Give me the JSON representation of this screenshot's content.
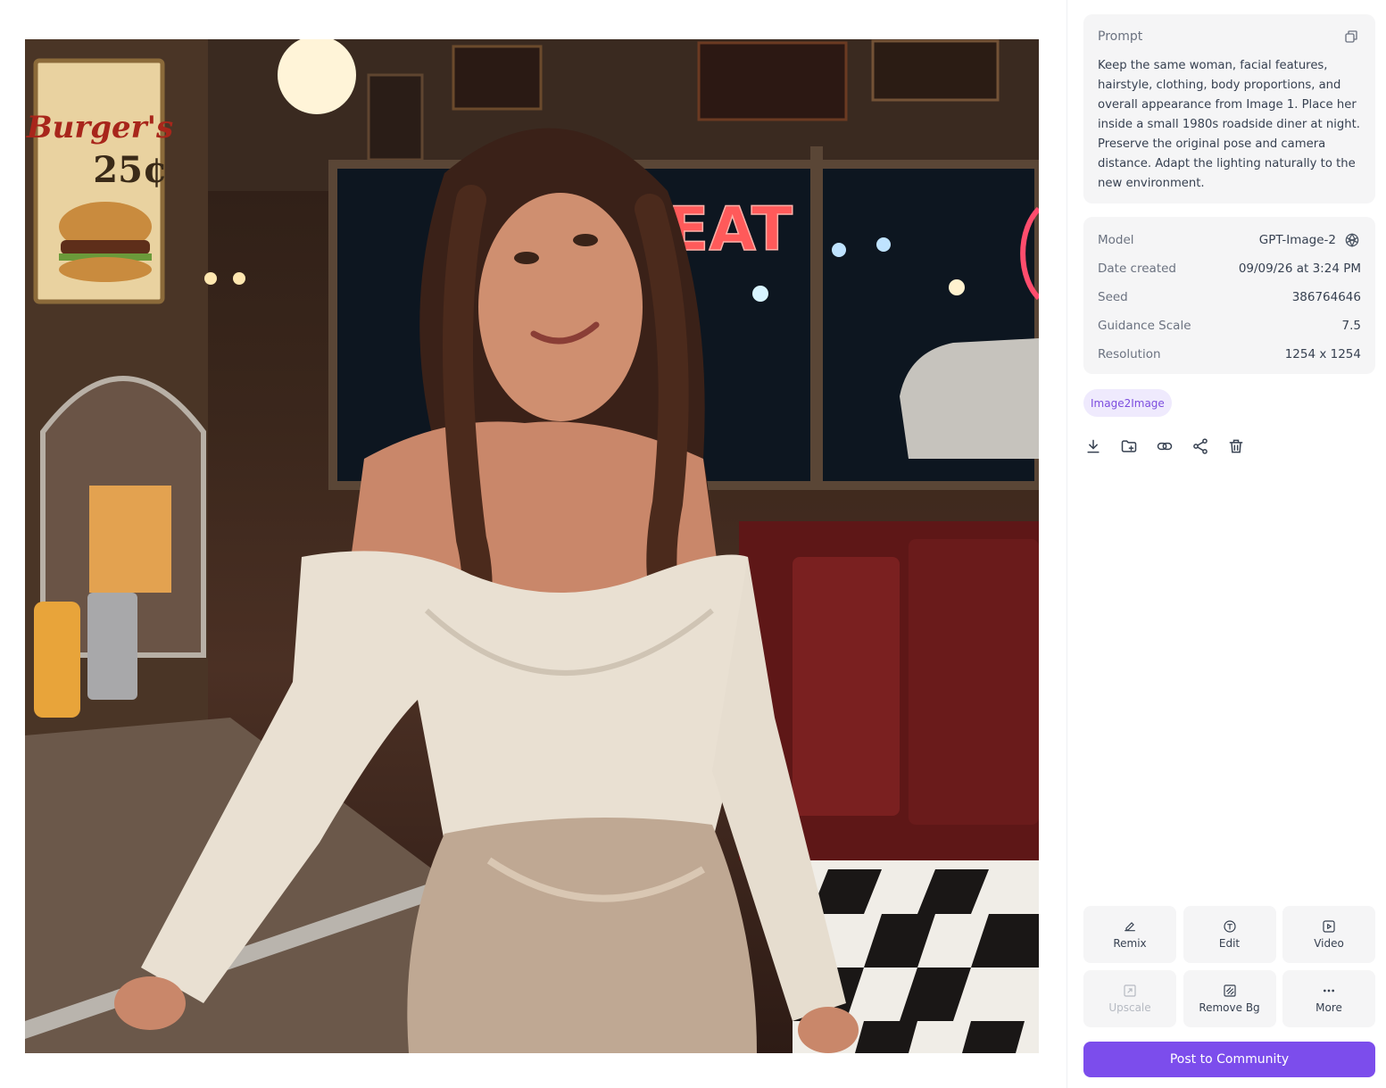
{
  "image": {
    "description_icon": "generated-photo",
    "sign_text": "Burger's",
    "sign_price": "25¢",
    "neon_text": "EAT"
  },
  "prompt": {
    "label": "Prompt",
    "text": "Keep the same woman, facial features, hairstyle, clothing, body proportions, and overall appearance from Image 1. Place her inside a small 1980s roadside diner at night. Preserve the original pose and camera distance. Adapt the lighting naturally to the new environment.",
    "copy_icon": "copy-icon"
  },
  "meta": {
    "model_label": "Model",
    "model_value": "GPT-Image-2",
    "model_icon": "openai-logo-icon",
    "date_label": "Date created",
    "date_value": "09/09/26 at 3:24 PM",
    "seed_label": "Seed",
    "seed_value": "386764646",
    "guidance_label": "Guidance Scale",
    "guidance_value": "7.5",
    "resolution_label": "Resolution",
    "resolution_value": "1254 x 1254"
  },
  "tag": "Image2Image",
  "actions": [
    "download-icon",
    "add-to-folder-icon",
    "link-icon",
    "share-icon",
    "trash-icon"
  ],
  "tools": {
    "remix": "Remix",
    "edit": "Edit",
    "video": "Video",
    "upscale": "Upscale",
    "remove_bg": "Remove Bg",
    "more": "More"
  },
  "post_button": "Post to Community",
  "colors": {
    "accent": "#7c4dec",
    "tag_bg": "#efeafd",
    "tag_text": "#7c4dde",
    "card_bg": "#f5f5f6"
  }
}
